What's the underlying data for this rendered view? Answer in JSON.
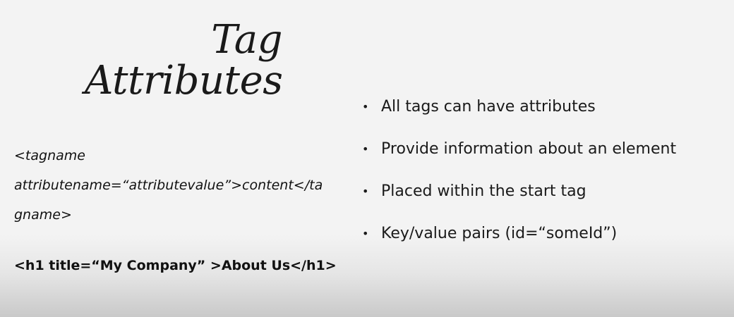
{
  "slide": {
    "title_line1": "Tag",
    "title_line2": "Attributes",
    "syntax_lines": [
      "<tagname",
      "attributename=“attributevalue”>content</ta",
      "gname>"
    ],
    "example": "<h1 title=“My Company” >About Us</h1>",
    "bullet_glyph": "•",
    "bullets": [
      "All tags can have attributes",
      "Provide information about an element",
      "Placed within the start tag",
      "Key/value pairs (id=“someId”)"
    ]
  }
}
